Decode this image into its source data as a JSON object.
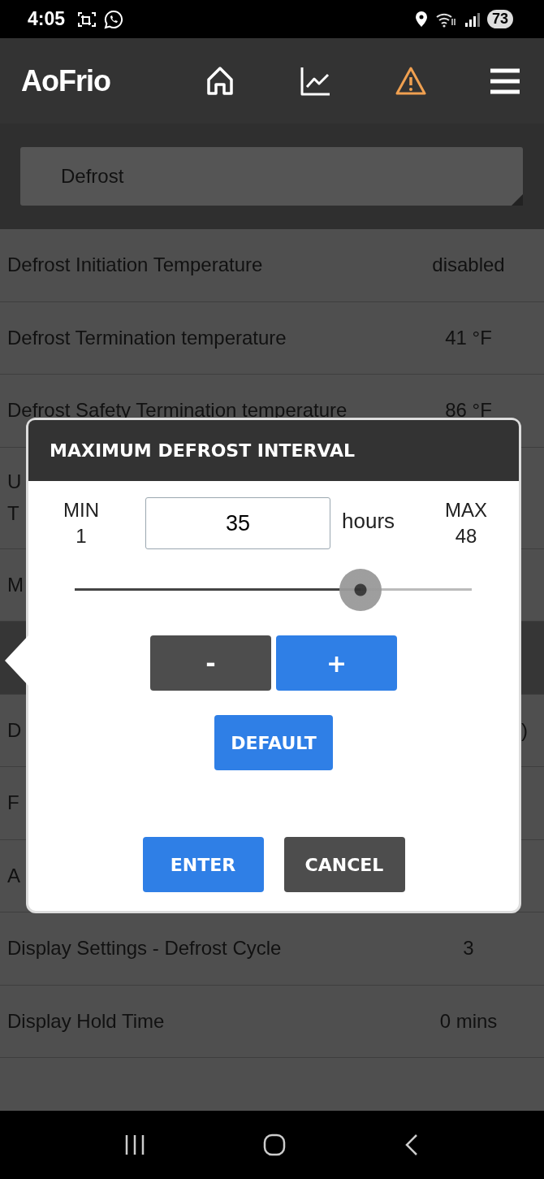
{
  "status_bar": {
    "time": "4:05",
    "battery": "73"
  },
  "header": {
    "logo": "AoFrio"
  },
  "section_select": {
    "value": "Defrost"
  },
  "settings": [
    {
      "lines": [
        "Defrost Initiation Temperature"
      ],
      "value": "disabled",
      "selected": false
    },
    {
      "lines": [
        "Defrost Termination temperature"
      ],
      "value": "41 °F",
      "selected": false
    },
    {
      "lines": [
        "Defrost Safety Termination temperature"
      ],
      "value": "86 °F",
      "selected": false
    },
    {
      "lines": [
        "U",
        "T"
      ],
      "selected": false
    },
    {
      "lines": [
        "M"
      ],
      "selected": false
    },
    {
      "selected": true
    },
    {
      "lines": [
        "D"
      ],
      "value": ")",
      "selected": false
    },
    {
      "lines": [
        "F"
      ],
      "selected": false
    },
    {
      "lines": [
        "A"
      ],
      "selected": false
    },
    {
      "lines": [
        "Display Settings - Defrost Cycle"
      ],
      "value": "3",
      "selected": false
    },
    {
      "lines": [
        "Display Hold Time"
      ],
      "value": "0 mins",
      "selected": false
    }
  ],
  "dialog": {
    "title": "MAXIMUM DEFROST INTERVAL",
    "min_label": "MIN",
    "min_value": "1",
    "max_label": "MAX",
    "max_value": "48",
    "value": "35",
    "unit": "hours",
    "level": 0.72,
    "step_buttons": [
      {
        "label": "-",
        "kind": "secondary"
      },
      {
        "label": "+",
        "kind": "primary"
      }
    ],
    "default_button": {
      "label": "DEFAULT",
      "kind": "primary"
    },
    "actions": [
      {
        "label": "ENTER",
        "kind": "primary"
      },
      {
        "label": "CANCEL",
        "kind": "secondary"
      }
    ]
  }
}
